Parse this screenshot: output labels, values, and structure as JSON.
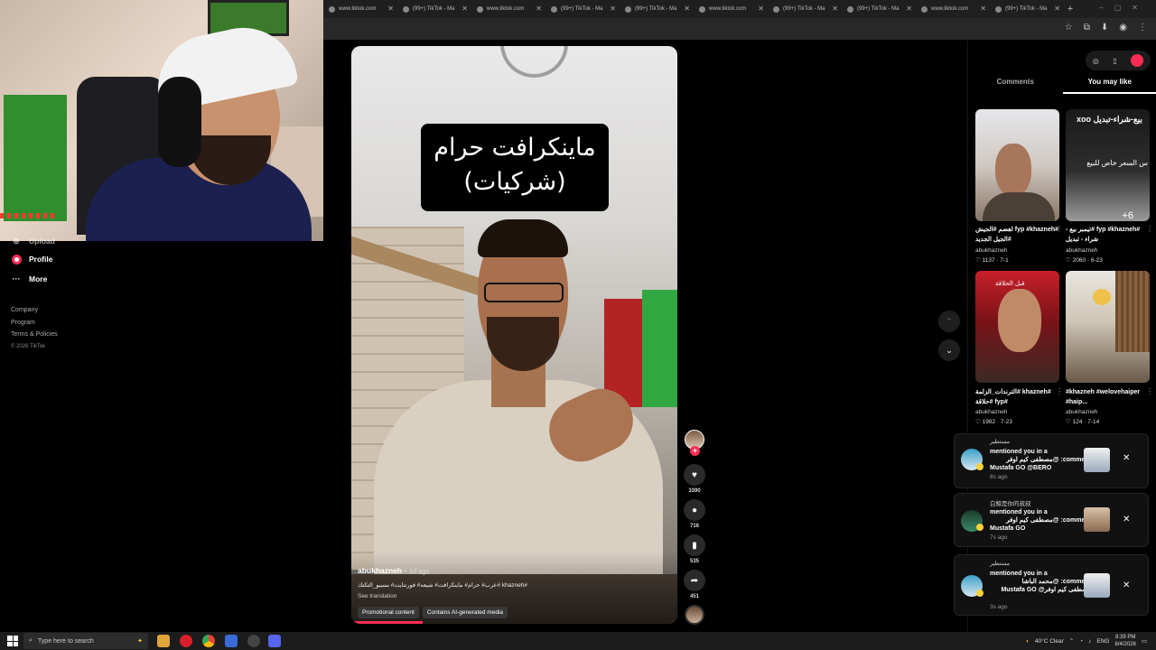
{
  "browser": {
    "tabs": [
      {
        "label": "www.tiktok.com"
      },
      {
        "label": "(99+) TikTok - Ma"
      },
      {
        "label": "www.tiktok.com"
      },
      {
        "label": "(99+) TikTok - Ma"
      },
      {
        "label": "(99+) TikTok - Ma"
      },
      {
        "label": "www.tiktok.com"
      },
      {
        "label": "(99+) TikTok - Ma"
      },
      {
        "label": "(99+) TikTok - Ma"
      },
      {
        "label": "www.tiktok.com"
      },
      {
        "label": "(99+) TikTok - Ma"
      }
    ],
    "new_tab": "+"
  },
  "sidebar": {
    "partial_item": "Upload",
    "items": [
      {
        "label": "Profile",
        "icon": "profile-icon"
      },
      {
        "label": "More",
        "icon": "more-icon"
      }
    ],
    "footer_links": [
      "Company",
      "Program",
      "Terms & Policies"
    ],
    "copyright": "© 2026 TikTok"
  },
  "video": {
    "caption_line1": "ماينكرافت حرام",
    "caption_line2": "(شركيات)",
    "author": "abukhazneh",
    "posted": "1d ago",
    "description": "#khazneh #عرب# حرام# ماينكرافت# شيعه# فورتنايت# مسيو_التكتك",
    "see_translation": "See translation",
    "tags": [
      "Promotional content",
      "Contains AI-generated media"
    ],
    "progress": 0.22
  },
  "actions": {
    "follow": "+",
    "likes": "3390",
    "comments": "716",
    "saves": "535",
    "shares": "451"
  },
  "right_panel": {
    "tabs": [
      "Comments",
      "You may like"
    ],
    "active_tab": "You may like",
    "recommendations": [
      {
        "caption": "#fyp #khazneh اهضم #الجيش #الجيل الجديد",
        "author": "abukhazneh",
        "likes": "1137",
        "date": "7-1"
      },
      {
        "caption": "#fyp #khazneh #تيمبر بيع - شراء - تبديل",
        "author": "abukhazneh",
        "likes": "2060",
        "date": "6-23",
        "thumb_title": "بيع-شراء-تبديل xoo",
        "thumb_sub": "س السعر خاص للبيع",
        "thumb_plus": "+6"
      },
      {
        "caption": "#khazneh #الترندات_الزلمة #fyp #حلاقة",
        "author": "abukhazneh",
        "likes": "1982",
        "date": "7-23",
        "thumb_caption": "قبل الحلاقة"
      },
      {
        "caption": "#khazneh #welovehaiper #haip...",
        "author": "abukhazneh",
        "likes": "124",
        "date": "7-14"
      }
    ]
  },
  "notifications": [
    {
      "user": "مستطير",
      "body_1": "mentioned you in a",
      "body_2": "comment: @مصطفى كيم اوفر",
      "body_3": "Mustafa GO @BERO",
      "time": "8s ago"
    },
    {
      "user": "白鲸是你的叔叔",
      "body_1": "mentioned you in a",
      "body_2": "comment: @مصطفى كيم اوفر",
      "body_3": "Mustafa GO",
      "time": "7s ago"
    },
    {
      "user": "مستطير",
      "body_1": "mentioned you in a",
      "body_2": "comment: @محمد الباشا",
      "body_3": "مصطفى كيم اوفر@ Mustafa GO",
      "time": "3s ago"
    }
  ],
  "taskbar": {
    "search_placeholder": "Type here to search",
    "weather": "40°C  Clear",
    "lang": "ENG",
    "time": "8:39 PM",
    "date": "8/4/2026"
  },
  "colors": {
    "accent": "#fe2c55",
    "background": "#000000"
  }
}
